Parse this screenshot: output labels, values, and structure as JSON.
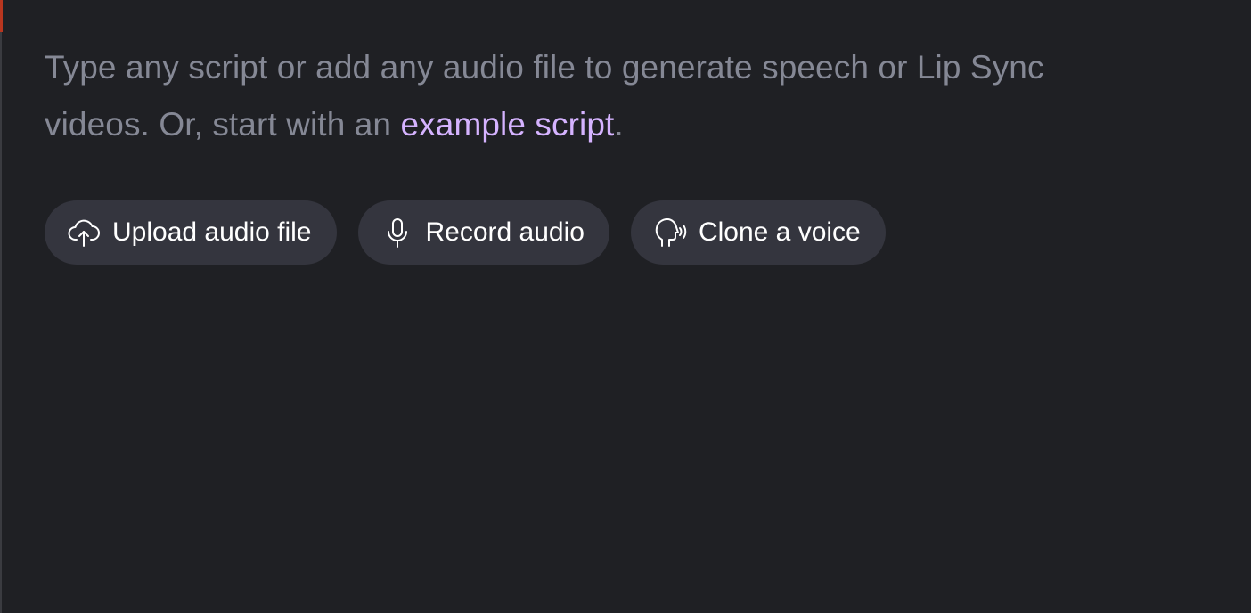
{
  "editor": {
    "placeholder_text": "Type any script or add any audio file to generate speech or Lip Sync videos. Or, start with an ",
    "example_link": "example script",
    "trailing_punct": "."
  },
  "actions": {
    "upload": {
      "label": "Upload audio file",
      "icon": "cloud-upload-icon"
    },
    "record": {
      "label": "Record audio",
      "icon": "microphone-icon"
    },
    "clone": {
      "label": "Clone a voice",
      "icon": "voice-clone-icon"
    }
  },
  "colors": {
    "background": "#1f2024",
    "placeholder": "#858895",
    "link": "#d5b3ff",
    "button_bg": "#34353e",
    "button_text": "#ffffff"
  }
}
